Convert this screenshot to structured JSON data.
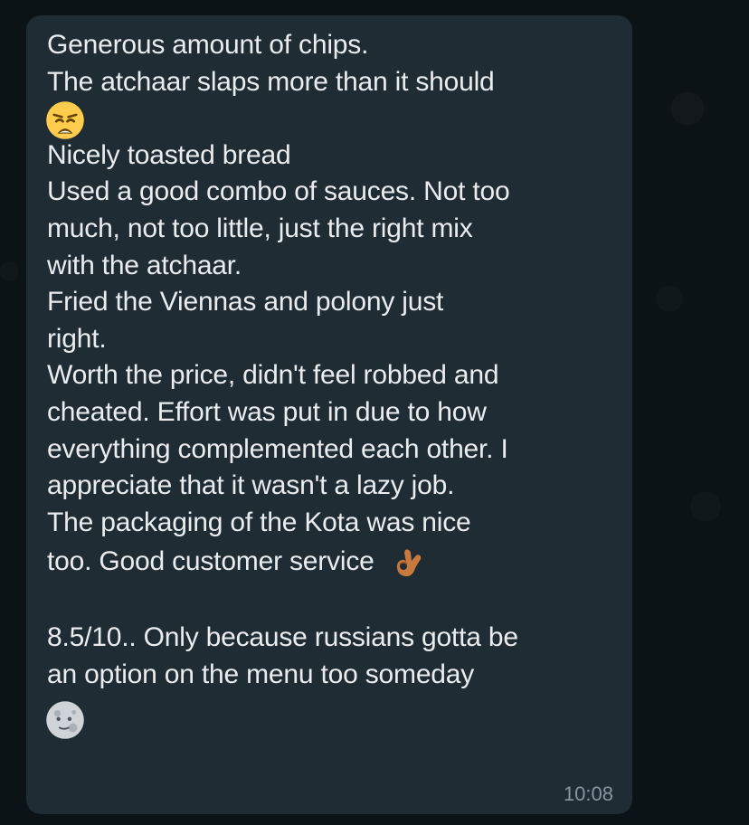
{
  "message": {
    "lines": [
      "Generous amount of chips.",
      "The atchaar slaps more than it should",
      "Nicely toasted bread",
      "Used a good combo of sauces. Not too",
      "much, not too little, just the right mix",
      "with the atchaar.",
      "Fried the Viennas and polony just",
      "right.",
      "Worth the price, didn't feel robbed and",
      "cheated. Effort was put in due to how",
      "everything complemented each other. I",
      "appreciate that it wasn't a lazy job.",
      "The packaging of the Kota was nice",
      "too. Good customer service",
      "8.5/10.. Only because russians gotta be",
      "an option on the menu too someday"
    ],
    "emojis": {
      "weary": "weary-face-emoji",
      "ok": "ok-hand-emoji",
      "moon": "full-moon-face-emoji"
    },
    "timestamp": "10:08"
  },
  "colors": {
    "background": "#0c1317",
    "bubble": "#1f2c34",
    "text": "#e9edef",
    "timestamp": "#8696a0"
  }
}
